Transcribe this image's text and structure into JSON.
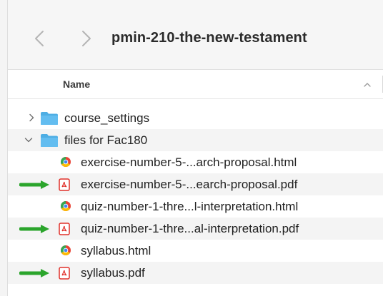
{
  "window": {
    "title": "pmin-210-the-new-testament"
  },
  "header": {
    "name_label": "Name"
  },
  "colors": {
    "folder": "#4eaee4",
    "pdf_red": "#e0302a",
    "arrow_green": "#2ba52c",
    "stripe": "#f4f4f4"
  },
  "tree": {
    "folder_course_settings": {
      "label": "course_settings",
      "icon": "folder-icon",
      "expanded": false
    },
    "folder_files": {
      "label": "files for Fac180",
      "icon": "folder-icon",
      "expanded": true
    },
    "files": [
      {
        "label": "exercise-number-5-...arch-proposal.html",
        "icon": "chrome-html-icon",
        "arrow": false
      },
      {
        "label": "exercise-number-5-...earch-proposal.pdf",
        "icon": "pdf-icon",
        "arrow": true
      },
      {
        "label": "quiz-number-1-thre...l-interpretation.html",
        "icon": "chrome-html-icon",
        "arrow": false
      },
      {
        "label": "quiz-number-1-thre...al-interpretation.pdf",
        "icon": "pdf-icon",
        "arrow": true
      },
      {
        "label": "syllabus.html",
        "icon": "chrome-html-icon",
        "arrow": false
      },
      {
        "label": "syllabus.pdf",
        "icon": "pdf-icon",
        "arrow": true
      }
    ]
  }
}
